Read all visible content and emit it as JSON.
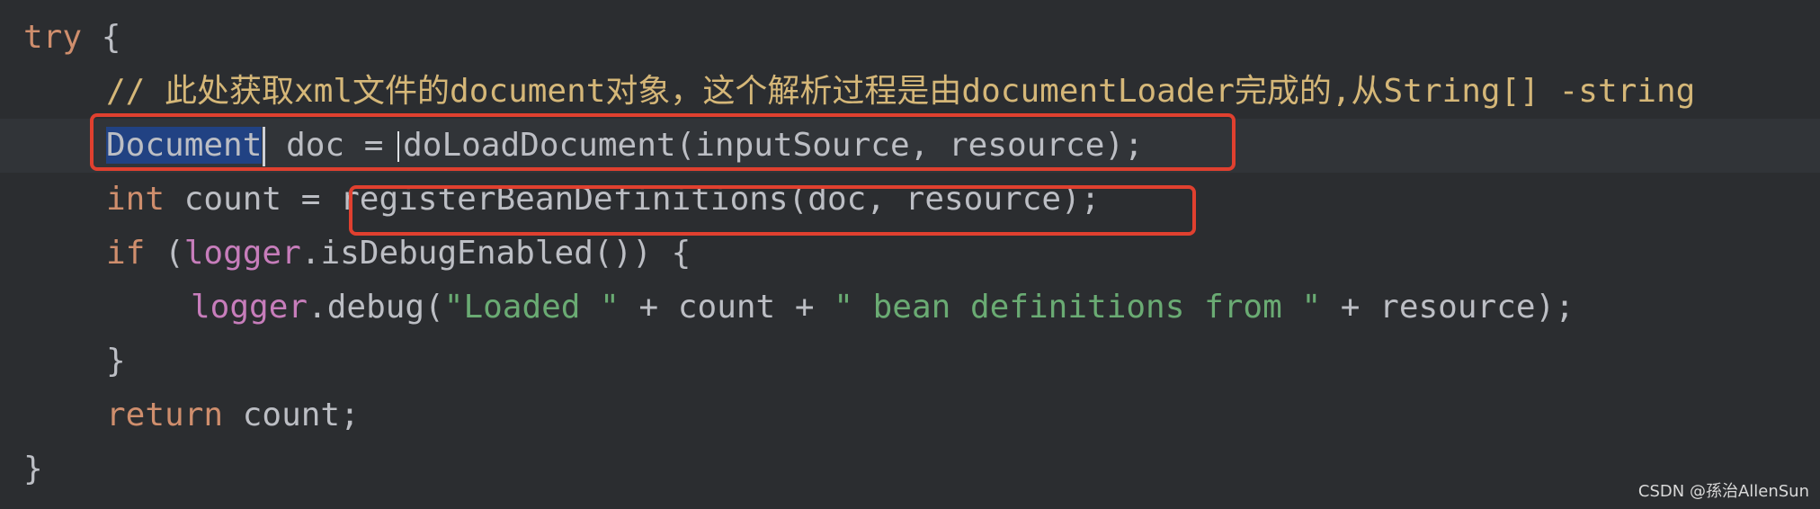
{
  "code": {
    "l1_try": "try",
    "l1_brace": " {",
    "l2_comment": "// 此处获取xml文件的document对象，这个解析过程是由documentLoader完成的,从String[] -string",
    "l3_selected": "Document",
    "l3_rest_a": " doc = ",
    "l3_rest_b": "doLoadDocument(inputSource, resource);",
    "l4_int": "int",
    "l4_mid": " count = ",
    "l4_call": "registerBeanDefinitions(doc, resource);",
    "l5_if": "if",
    "l5_open": " (",
    "l5_logger": "logger",
    "l5_rest": ".isDebugEnabled()) {",
    "l6_logger": "logger",
    "l6_call": ".debug(",
    "l6_str1": "\"Loaded \"",
    "l6_mid": " + count + ",
    "l6_str2": "\" bean definitions from \"",
    "l6_end": " + resource);",
    "l7_brace": "}",
    "l8_return": "return",
    "l8_rest": " count;",
    "l9_brace": "}"
  },
  "watermark": "CSDN @孫治AllenSun",
  "colors": {
    "background": "#2b2d30",
    "keyword": "#cf8e6d",
    "comment": "#d5b778",
    "string": "#6aab73",
    "field": "#c77dbb",
    "selection": "#214283",
    "highlight_box": "#e0402f"
  }
}
